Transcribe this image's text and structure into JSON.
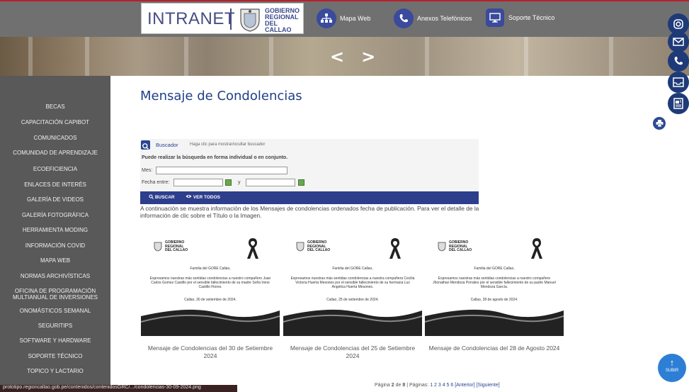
{
  "header": {
    "logo_text": "INTRANET",
    "gobierno_lines": [
      "GOBIERNO",
      "REGIONAL",
      "DEL CALLAO"
    ],
    "nav": [
      {
        "label": "Mapa Web",
        "icon": "sitemap-icon"
      },
      {
        "label": "Anexos Telefónicos",
        "icon": "phone-icon"
      },
      {
        "label": "Soporte Técnico",
        "icon": "monitor-icon"
      }
    ]
  },
  "banner": {
    "prev": "<",
    "next": ">"
  },
  "social_icons": [
    "instagram-icon",
    "mail-icon",
    "phone-icon",
    "inbox-icon",
    "newspaper-icon"
  ],
  "sidebar": {
    "items": [
      "BECAS",
      "CAPACITACIÓN CAPIBOT",
      "COMUNICADOS",
      "COMUNIDAD DE APRENDIZAJE",
      "ECOEFICIENCIA",
      "ENLACES DE INTERÉS",
      "GALERÍA DE VIDEOS",
      "GALERÍA FOTOGRÁFICA",
      "HERRAMIENTA MODING",
      "INFORMACIÓN COVID",
      "MAPA WEB",
      "NORMAS ARCHIVÍSTICAS",
      "OFICINA DE PROGRAMACIÓN MULTIANUAL DE INVERSIONES",
      "ONOMÁSTICOS SEMANAL",
      "SEGURITIPS",
      "SOFTWARE Y HARDWARE",
      "SOPORTE TÉCNICO",
      "TOPICO Y LACTARIO"
    ]
  },
  "page": {
    "title": "Mensaje de Condolencias"
  },
  "search": {
    "label": "Buscador",
    "hint": "Haga clic para mostrar/ocultar buscador",
    "description": "Puede realizar la búsqueda en forma individual o en conjunto.",
    "mes_label": "Mes:",
    "fecha_label": "Fecha entre:",
    "y_label": "y",
    "buscar": "BUSCAR",
    "ver_todos": "VER TODOS"
  },
  "intro": "A continuación se muestra información de los Mensajes de condolencias ordenados fecha de publicación. Para ver el detalle de la información de clic sobre el Título o la Imagen.",
  "cards": [
    {
      "header": "Familia del GORE Callao,",
      "body": "Expresamos nuestras más sentidas condolencias a nuestro compañero Juan Carlos Gomez Castillo por el sensible fallecimiento de su madre Sofía Irene Castillo Flores.",
      "date": "Callao, 30 de setiembre de 2024.",
      "caption": "Mensaje de Condolencias del 30 de Setiembre 2024"
    },
    {
      "header": "Familia del GORE Callao,",
      "body": "Expresamos nuestras más sentidas condolencias a nuestra compañera Cecilia Victoria Huerta Mesones por el sensible fallecimiento de su hermana Luz Angelica Huerta Mesones.",
      "date": "Callao, 25 de setiembre de 2024.",
      "caption": "Mensaje de Condolencias del 25 de Setiembre 2024"
    },
    {
      "header": "Familia del GORE Callao,",
      "body": "Expresamos nuestras más sentidas condolencias a nuestro compañero Jhonathan Mendoza Porrales por el sensible fallecimiento de su padre Manuel Mendoza García.",
      "date": "Callao, 28 de agosto de 2024.",
      "caption": "Mensaje de Condolencias del 28 de Agosto 2024"
    }
  ],
  "pagination": {
    "prefix": "Página",
    "current": "2",
    "of": "de",
    "total": "8",
    "pages_label": "| Páginas:",
    "pages": "1 2 3 4 5 6",
    "prev": "[Anterior]",
    "next": "[Siguiente]"
  },
  "statusbar": "prototipo.regioncallao.gob.pe/contenidos/contenidosGRC/.../condolencias-30-09-2024.png",
  "subir": {
    "arrow": "↑",
    "label": "SUBIR"
  },
  "colors": {
    "sidebar": "#595959",
    "header": "#707070",
    "accent": "#2d3e8c",
    "title": "#1f3f87"
  }
}
